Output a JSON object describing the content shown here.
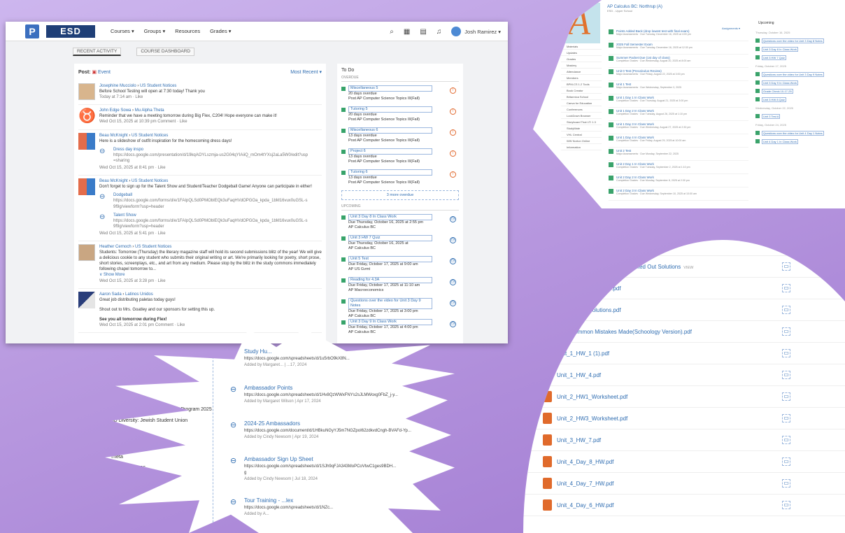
{
  "main": {
    "logo_p": "P",
    "logo_esd": "ESD",
    "nav": [
      "Courses ▾",
      "Groups ▾",
      "Resources",
      "Grades ▾"
    ],
    "user": "Josh Ramirez ▾",
    "tabs": [
      "RECENT ACTIVITY",
      "COURSE DASHBOARD"
    ],
    "post_label": "Post:",
    "post_type": "Event",
    "sort": "Most Recent ▾",
    "posts": [
      {
        "author": "Josephine Mucciolo",
        "group": "US Student Notices",
        "text": "Before School Testing will open at 7:30 today!  Thank you",
        "meta": "Today at 7:14 am · Like"
      },
      {
        "author": "John Edge Sowa",
        "group": "Mu Alpha Theta",
        "text": "Reminder that we have a meeting tomorrow during Big Flex, C204! Hope everyone can make it!",
        "meta": "Wed Oct 15, 2025 at 10:39 pm  Comment · Like"
      },
      {
        "author": "Beau McKnight",
        "group": "US Student Notices",
        "text": "Here is a slideshow of outfit inspiration for the homecoming dress days!",
        "att_title": "Dress day inspo",
        "att_url": "https://docs.google.com/presentation/d/19kqAOYLszmja-us2G04qYIAiiQ_mOm4tYXsj2aLa5W0/edit?usp=sharing",
        "meta": "Wed Oct 15, 2025 at 8:41 pm · Like"
      },
      {
        "author": "Beau McKnight",
        "group": "US Student Notices",
        "text": "Don't forget to sign up for the Talent Show and Student/Teacher Dodgeball Game! Anyone can participate in either!",
        "att1_title": "Dodgeball",
        "att1_url": "https://docs.google.com/forms/d/e/1FAIpQLSd0PMObIEQk3uFaqHVdOPGOa_kpda_1bM16vux0uGSL-s9f9g/viewform?usp=header",
        "att2_title": "Talent Show",
        "att2_url": "https://docs.google.com/forms/d/e/1FAIpQLSd0PMObIEQk3uFaqHVdOPGOa_kpda_1bM16vux0uGSL-s9f9g/viewform?usp=header",
        "meta": "Wed Oct 15, 2025 at 5:41 pm · Like"
      },
      {
        "author": "Heather Cernoch",
        "group": "US Student Notices",
        "text": "Students: Tomorrow (Thursday) the literary magazine staff will hold its second submissions blitz of the year! We will give a delicious cookie to any student who submits their original writing or art. We're primarily looking for poetry, short prose, short stories, screenplays, etc., and art from any medium. Please stop by the blitz in the study commons immediately following chapel tomorrow to...",
        "show_more": "∨ Show More",
        "meta": "Wed Oct 15, 2025 at 3:28 pm · Like"
      },
      {
        "author": "Aaron Sada",
        "group": "Latinos Unidos",
        "text": "Great job distributing paletas today guys!",
        "text2": "Shout out to Mrs. Goatley and our sponsors for setting this up.",
        "text3": "See you all tomorrow during Flex!",
        "meta": "Wed Oct 15, 2025 at 2:01 pm  Comment · Like"
      }
    ],
    "todo_title": "To Do",
    "overdue_label": "OVERDUE",
    "upcoming_label": "UPCOMING",
    "overdue": [
      {
        "title": "Miscellaneous 5",
        "due": "20 days overdue",
        "course": "Post AP Computer Science Topics III(Fall)"
      },
      {
        "title": "Tutoring 5",
        "due": "20 days overdue",
        "course": "Post AP Computer Science Topics III(Fall)"
      },
      {
        "title": "Miscellaneous 6",
        "due": "13 days overdue",
        "course": "Post AP Computer Science Topics III(Fall)"
      },
      {
        "title": "Project 6",
        "due": "13 days overdue",
        "course": "Post AP Computer Science Topics III(Fall)"
      },
      {
        "title": "Tutoring 6",
        "due": "13 days overdue",
        "course": "Post AP Computer Science Topics III(Fall)"
      }
    ],
    "more_overdue": "3 more overdue",
    "upcoming": [
      {
        "title": "Unit 3 Day 8 In Class Work",
        "due": "Due Thursday, October 16, 2025 at 2:55 pm",
        "course": "AP Calculus BC"
      },
      {
        "title": "Unit 3 HW 7 Quiz",
        "due": "Due Thursday, October 16, 2025 at",
        "course": "AP Calculus BC"
      },
      {
        "title": "Unit 5 Test",
        "due": "Due Friday, October 17, 2025 at 9:00 am",
        "course": "AP US Gvmt"
      },
      {
        "title": "Reading for 4.3A",
        "due": "Due Friday, October 17, 2025 at 11:10 am",
        "course": "AP Macroeconomics"
      },
      {
        "title": "Questions over the video for Unit 3 Day 9 Notes",
        "due": "Due Friday, October 17, 2025 at 3:00 pm",
        "course": "AP Calculus BC"
      },
      {
        "title": "Unit 3 Day 9 In Class Work",
        "due": "Due Friday, October 17, 2025 at 4:00 pm",
        "course": "AP Calculus BC"
      }
    ]
  },
  "topright": {
    "title": "AP Calculus BC: Northrup (A)",
    "subtitle": "ESD - Upper School",
    "cover_letter": "A",
    "side": [
      "Materials",
      "Updates",
      "Grades",
      "Mastery",
      "Attendance",
      "Members",
      "BPM-CS 1.2 Tools",
      "Book Creator",
      "Britannica School",
      "Canva for Education",
      "Conferences",
      "LockDown Browser",
      "Storyboard That LTI 1.3",
      "StudyMate",
      "VHL Central",
      "WW Norton Online",
      "Information"
    ],
    "assignments_label": "Assignments ▾",
    "materials": [
      {
        "t": "Points Added Back (drop lowest test with final exam)",
        "s": "Major Assessments · Due Tuesday, December 16, 2025 at 4:00 pm"
      },
      {
        "t": "2025 Fall Semester Exam",
        "s": "Major Assessments · Due Tuesday, December 16, 2025 at 12:30 pm"
      },
      {
        "t": "Summer Packet Due (1st day of class)",
        "s": "Completion Grades · Due Wednesday, August 20, 2025 at 8:00 am"
      },
      {
        "t": "Unit 0 Test (Precalculus Review)",
        "s": "Major Assessments · Due Friday, August 22, 2025 at 3:00 pm"
      },
      {
        "t": "Unit 1 Test",
        "s": "Major Assessments · Due Wednesday, September 3, 2025"
      },
      {
        "t": "Unit 1 Day 1 In Class Work",
        "s": "Completion Grades · Due Thursday, August 21, 2025 at 3:00 pm"
      },
      {
        "t": "Unit 1 Day 2 In Class Work",
        "s": "Completion Grades · Due Tuesday, August 26, 2025 at 1:10 pm"
      },
      {
        "t": "Unit 1 Day 3 In Class Work",
        "s": "Completion Grades · Due Wednesday, August 27, 2025 at 2:30 pm"
      },
      {
        "t": "Unit 1 Day 4 In Class Work",
        "s": "Completion Grades · Due Friday, August 29, 2025 at 10:00 am"
      },
      {
        "t": "Unit 2 Test",
        "s": "Major Assessments · Due Monday, September 22, 2025"
      },
      {
        "t": "Unit 2 Day 1 In Class Work",
        "s": "Completion Grades · Due Tuesday, September 2, 2025 at 1:10 pm"
      },
      {
        "t": "Unit 2 Day 2 In Class Work",
        "s": "Completion Grades · Due Monday, September 8, 2025 at 2:30 pm"
      },
      {
        "t": "Unit 2 Day 3 In Class Work",
        "s": "Completion Grades · Due Wednesday, September 10, 2025 at 10:00 am"
      }
    ],
    "upcoming_title": "Upcoming",
    "upcoming": [
      "Thursday, October 16, 2025",
      "Questions over the video for Unit 3 Day 8 Notes",
      "Unit 3 Day 8 In Class Work",
      "Unit 3 HW 7 Quiz",
      "Friday, October 17, 2025",
      "Questions over the video for Unit 3 Day 9 Notes",
      "Unit 3 Day 9 In Class Work",
      "Grade Check 10-17-25",
      "Unit 3 HW 8 Quiz",
      "Wednesday, October 22, 2025",
      "Unit 3 Test A",
      "Friday, October 24, 2025",
      "Questions over the video for Unit 4 Day 1 Notes",
      "Unit 4 Day 1 In Class Work"
    ]
  },
  "files": {
    "view_label": "VIEW",
    "rows": [
      {
        "name": "Formula List for AP Calculus BC.pdf",
        "type": "pdf-red",
        "view": true
      },
      {
        "name": "Summer Homework Packet Worked Out Solutions",
        "type": "pdf-red",
        "view": true
      },
      {
        "name": "Unit 5 HW 1 Solutions.pdf",
        "type": "doc",
        "view": false
      },
      {
        "name": "Unit 5 HW 2 Solutions.pdf",
        "type": "doc",
        "view": false
      },
      {
        "name": "Most Common Mistakes Made(Schoology Version).pdf",
        "type": "doc",
        "view": false
      },
      {
        "name": "Unit_1_HW_1 (1).pdf",
        "type": "pdf",
        "view": false
      },
      {
        "name": "Unit_1_HW_4.pdf",
        "type": "pdf",
        "view": false
      },
      {
        "name": "Unit_2_HW1_Worksheet.pdf",
        "type": "pdf",
        "view": false
      },
      {
        "name": "Unit_2_HW3_Worksheet.pdf",
        "type": "pdf",
        "view": false
      },
      {
        "name": "Unit_3_HW_7.pdf",
        "type": "pdf",
        "view": false
      },
      {
        "name": "Unit_4_Day_8_HW.pdf",
        "type": "pdf",
        "view": false
      },
      {
        "name": "Unit_4_Day_7_HW.pdf",
        "type": "pdf",
        "view": false
      },
      {
        "name": "Unit_4_Day_6_HW.pdf",
        "type": "pdf",
        "view": false
      }
    ]
  },
  "starburst": {
    "left": [
      "2024",
      "Robotics (BFS)",
      "Eastin Family WORX Internship Program 2025",
      "SD Diversity: Jewish Student Union",
      "nders",
      "Theta",
      "NHS 2025-2026"
    ],
    "entries": [
      {
        "title": "Study Hu...",
        "url": "https://docs.google.com/spreadsheets/d/1u5rbO9kX8N...",
        "added": "Added by Margaret...  |  ...17, 2024"
      },
      {
        "title": "Ambassador Points",
        "url": "https://docs.google.com/spreadsheets/d/1Hv8QzWWxFNYs2sJLMWoxg0FbZ_j-y...",
        "added": "Added by Margaret Wilson  |  Apr 17, 2024"
      },
      {
        "title": "2024-25 Ambassadors",
        "url": "https://docs.google.com/document/d/1HBkuNGyYJ5m7NGZpoI62zdkvdCngh-BVAFd-Yp...",
        "added": "Added by Cindy Newsom  |  Apr 19, 2024"
      },
      {
        "title": "Ambassador Sign Up Sheet",
        "url": "https://docs.google.com/spreadsheets/d/1SJh9qFJA343MoPCoVtwC1ges9BDH...",
        "url2": "g",
        "added": "Added by Cindy Newsom  |  Jul 18, 2024"
      },
      {
        "title": "Tour Training - ...lex",
        "url": "https://docs.google.com/spreadsheets/d/1NZc...",
        "added": "Added by A..."
      }
    ]
  }
}
